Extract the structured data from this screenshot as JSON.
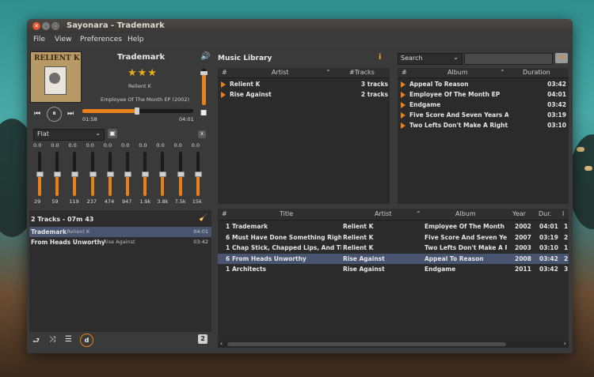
{
  "window": {
    "title": "Sayonara - Trademark"
  },
  "menu": {
    "file": "File",
    "view": "View",
    "preferences": "Preferences",
    "help": "Help"
  },
  "now_playing": {
    "cover_text": "RELIENT K",
    "title": "Trademark",
    "rating": "★★★",
    "artist": "Relient K",
    "album": "Employee Of The Month EP (2002)",
    "time_elapsed": "01:58",
    "time_total": "04:01",
    "progress": 0.49,
    "volume": 0.9
  },
  "equalizer": {
    "preset": "Flat",
    "close_label": "x",
    "bands": [
      {
        "value": "0.0",
        "freq": "29",
        "level": 0.5
      },
      {
        "value": "0.0",
        "freq": "59",
        "level": 0.5
      },
      {
        "value": "0.0",
        "freq": "119",
        "level": 0.5
      },
      {
        "value": "0.0",
        "freq": "237",
        "level": 0.5
      },
      {
        "value": "0.0",
        "freq": "474",
        "level": 0.5
      },
      {
        "value": "0.0",
        "freq": "947",
        "level": 0.5
      },
      {
        "value": "0.0",
        "freq": "1.9k",
        "level": 0.5
      },
      {
        "value": "0.0",
        "freq": "3.8k",
        "level": 0.5
      },
      {
        "value": "0.0",
        "freq": "7.5k",
        "level": 0.5
      },
      {
        "value": "0.0",
        "freq": "15k",
        "level": 0.5
      }
    ]
  },
  "playlist": {
    "summary": "2 Tracks - 07m 43",
    "items": [
      {
        "title": "Trademark",
        "artist": "Relient K",
        "duration": "04:01",
        "selected": true
      },
      {
        "title": "From Heads Unworthy",
        "artist": "Rise Against",
        "duration": "03:42",
        "selected": false
      }
    ],
    "bottom_badge": "2"
  },
  "library": {
    "title": "Music Library",
    "search_mode": "Search",
    "search_value": "",
    "artists": {
      "headers": {
        "num": "#",
        "artist": "Artist",
        "tracks": "#Tracks"
      },
      "rows": [
        {
          "name": "Relient K",
          "tracks": "3 tracks"
        },
        {
          "name": "Rise Against",
          "tracks": "2 tracks"
        }
      ]
    },
    "albums": {
      "headers": {
        "num": "#",
        "album": "Album",
        "duration": "Duration"
      },
      "rows": [
        {
          "name": "Appeal To Reason",
          "duration": "03:42"
        },
        {
          "name": "Employee Of The Month EP",
          "duration": "04:01"
        },
        {
          "name": "Endgame",
          "duration": "03:42"
        },
        {
          "name": "Five Score And Seven Years Ag",
          "duration": "03:19"
        },
        {
          "name": "Two Lefts Don't Make A Right...",
          "duration": "03:10"
        }
      ]
    },
    "tracks": {
      "headers": {
        "num": "#",
        "title": "Title",
        "artist": "Artist",
        "album": "Album",
        "year": "Year",
        "dur": "Dur.",
        "extra": "l"
      },
      "rows": [
        {
          "num": "1",
          "title": "Trademark",
          "artist": "Relient K",
          "album": "Employee Of The Month E",
          "year": "2002",
          "dur": "04:01",
          "extra": "1",
          "selected": false
        },
        {
          "num": "6",
          "title": "Must Have Done Something Right",
          "artist": "Relient K",
          "album": "Five Score And Seven Yea",
          "year": "2007",
          "dur": "03:19",
          "extra": "2",
          "selected": false
        },
        {
          "num": "1",
          "title": "Chap Stick, Chapped Lips, And Thi",
          "artist": "Relient K",
          "album": "Two Lefts Don't Make A Ri",
          "year": "2003",
          "dur": "03:10",
          "extra": "1",
          "selected": false
        },
        {
          "num": "6",
          "title": "From Heads Unworthy",
          "artist": "Rise Against",
          "album": "Appeal To Reason",
          "year": "2008",
          "dur": "03:42",
          "extra": "2",
          "selected": true
        },
        {
          "num": "1",
          "title": "Architects",
          "artist": "Rise Against",
          "album": "Endgame",
          "year": "2011",
          "dur": "03:42",
          "extra": "3",
          "selected": false
        }
      ]
    }
  },
  "colors": {
    "accent": "#e8801a",
    "selection": "#485470",
    "panel": "#2b2b2b"
  }
}
